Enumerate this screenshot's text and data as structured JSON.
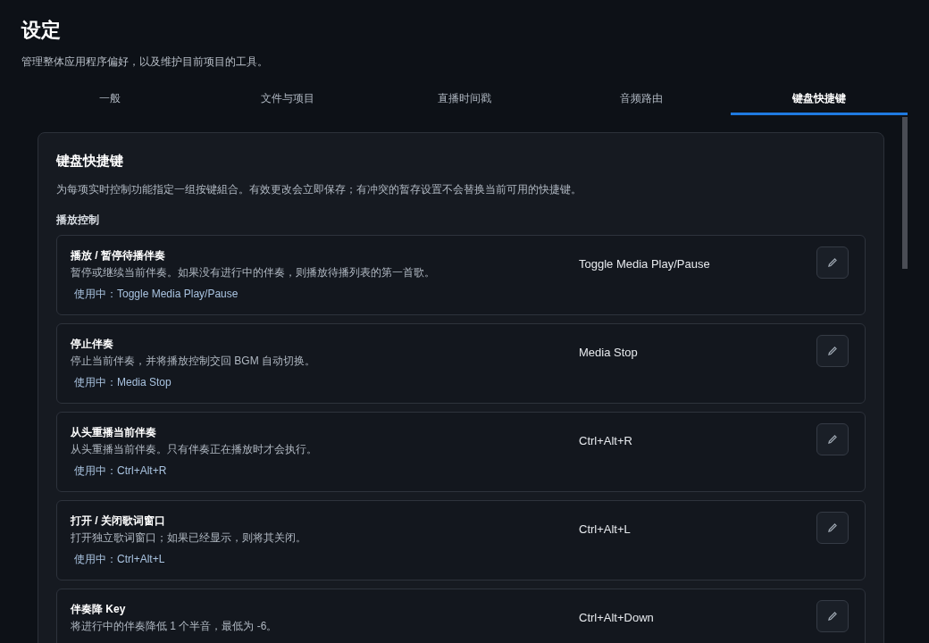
{
  "page": {
    "title": "设定",
    "subtitle": "管理整体应用程序偏好，以及维护目前项目的工具。"
  },
  "tabs": [
    {
      "label": "一般",
      "selected": false
    },
    {
      "label": "文件与项目",
      "selected": false
    },
    {
      "label": "直播时间戳",
      "selected": false
    },
    {
      "label": "音频路由",
      "selected": false
    },
    {
      "label": "键盘快捷键",
      "selected": true
    }
  ],
  "panel": {
    "title": "键盘快捷键",
    "description": "为每项实时控制功能指定一组按键組合。有效更改会立即保存；有冲突的暂存设置不会替换当前可用的快捷键。",
    "section": "播放控制",
    "shortcuts": [
      {
        "name": "播放 / 暂停待播伴奏",
        "description": "暂停或继续当前伴奏。如果没有进行中的伴奏，则播放待播列表的第一首歌。",
        "in_use": "使用中：Toggle Media Play/Pause",
        "binding": "Toggle Media Play/Pause"
      },
      {
        "name": "停止伴奏",
        "description": "停止当前伴奏，并将播放控制交回 BGM 自动切换。",
        "in_use": "使用中：Media Stop",
        "binding": "Media Stop"
      },
      {
        "name": "从头重播当前伴奏",
        "description": "从头重播当前伴奏。只有伴奏正在播放时才会执行。",
        "in_use": "使用中：Ctrl+Alt+R",
        "binding": "Ctrl+Alt+R"
      },
      {
        "name": "打开 / 关闭歌词窗口",
        "description": "打开独立歌词窗口；如果已经显示，则将其关闭。",
        "in_use": "使用中：Ctrl+Alt+L",
        "binding": "Ctrl+Alt+L"
      },
      {
        "name": "伴奏降 Key",
        "description": "将进行中的伴奏降低 1 个半音，最低为 -6。",
        "binding": "Ctrl+Alt+Down"
      }
    ]
  }
}
